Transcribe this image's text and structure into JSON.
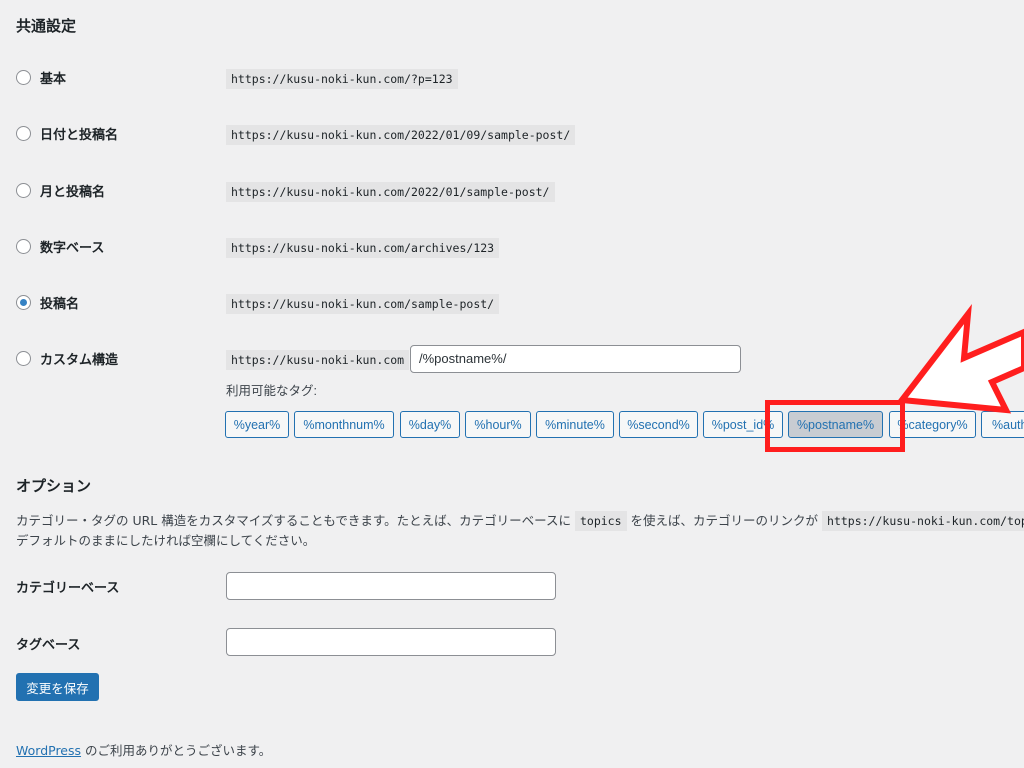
{
  "common": {
    "heading": "共通設定",
    "options": [
      {
        "label": "基本",
        "url": "https://kusu-noki-kun.com/?p=123",
        "checked": false
      },
      {
        "label": "日付と投稿名",
        "url": "https://kusu-noki-kun.com/2022/01/09/sample-post/",
        "checked": false
      },
      {
        "label": "月と投稿名",
        "url": "https://kusu-noki-kun.com/2022/01/sample-post/",
        "checked": false
      },
      {
        "label": "数字ベース",
        "url": "https://kusu-noki-kun.com/archives/123",
        "checked": false
      },
      {
        "label": "投稿名",
        "url": "https://kusu-noki-kun.com/sample-post/",
        "checked": true
      },
      {
        "label": "カスタム構造",
        "url": "https://kusu-noki-kun.com",
        "checked": false
      }
    ],
    "custom_value": "/%postname%/",
    "tags_label": "利用可能なタグ:",
    "tags": [
      "%year%",
      "%monthnum%",
      "%day%",
      "%hour%",
      "%minute%",
      "%second%",
      "%post_id%",
      "%postname%",
      "%category%",
      "%author%"
    ],
    "active_tag": "%postname%"
  },
  "options": {
    "heading": "オプション",
    "desc_line1_a": "カテゴリー・タグの URL 構造をカスタマイズすることもできます。たとえば、カテゴリーベースに",
    "desc_code1": "topics",
    "desc_line1_b": "を使えば、カテゴリーのリンクが",
    "desc_code2": "https://kusu-noki-kun.com/topics/",
    "desc_line2": "デフォルトのままにしたければ空欄にしてください。",
    "category_base_label": "カテゴリーベース",
    "category_base_value": "",
    "tag_base_label": "タグベース",
    "tag_base_value": ""
  },
  "save_label": "変更を保存",
  "footer": {
    "link": "WordPress",
    "text": " のご利用ありがとうございます。"
  },
  "colors": {
    "accent": "#2271b1",
    "highlight": "#ff1e1e"
  }
}
